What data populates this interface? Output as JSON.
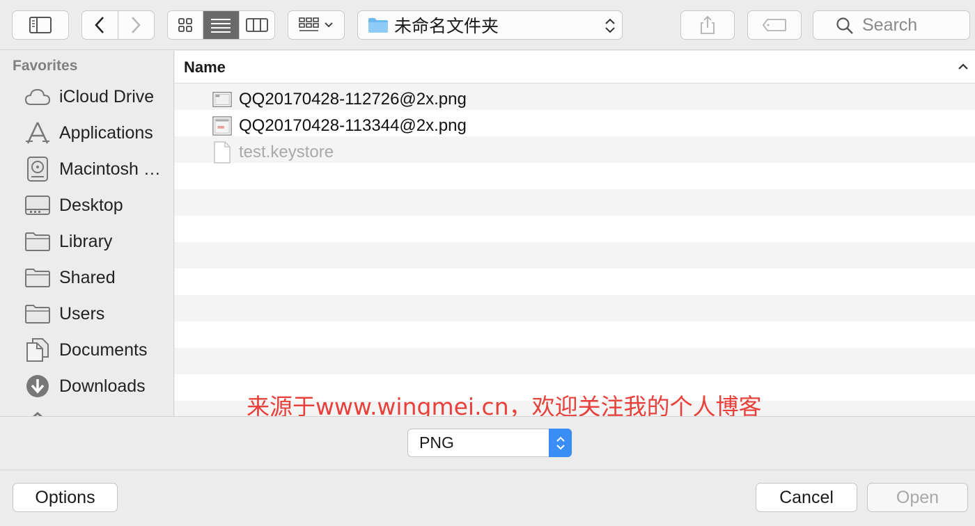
{
  "toolbar": {
    "path_label": "未命名文件夹",
    "search_placeholder": "Search"
  },
  "sidebar": {
    "heading": "Favorites",
    "items": [
      {
        "label": "iCloud Drive",
        "icon": "cloud-icon"
      },
      {
        "label": "Applications",
        "icon": "applications-icon"
      },
      {
        "label": "Macintosh HD",
        "icon": "hard-drive-icon"
      },
      {
        "label": "Desktop",
        "icon": "desktop-icon"
      },
      {
        "label": "Library",
        "icon": "folder-icon"
      },
      {
        "label": "Shared",
        "icon": "folder-icon"
      },
      {
        "label": "Users",
        "icon": "folder-icon"
      },
      {
        "label": "Documents",
        "icon": "documents-icon"
      },
      {
        "label": "Downloads",
        "icon": "downloads-icon"
      }
    ]
  },
  "list": {
    "column_name": "Name",
    "files": [
      {
        "name": "QQ20170428-112726@2x.png",
        "enabled": true
      },
      {
        "name": "QQ20170428-113344@2x.png",
        "enabled": true
      },
      {
        "name": "test.keystore",
        "enabled": false
      }
    ]
  },
  "watermark": "来源于www.wingmei.cn，欢迎关注我的个人博客",
  "format": {
    "selected": "PNG"
  },
  "buttons": {
    "options": "Options",
    "cancel": "Cancel",
    "open": "Open"
  }
}
